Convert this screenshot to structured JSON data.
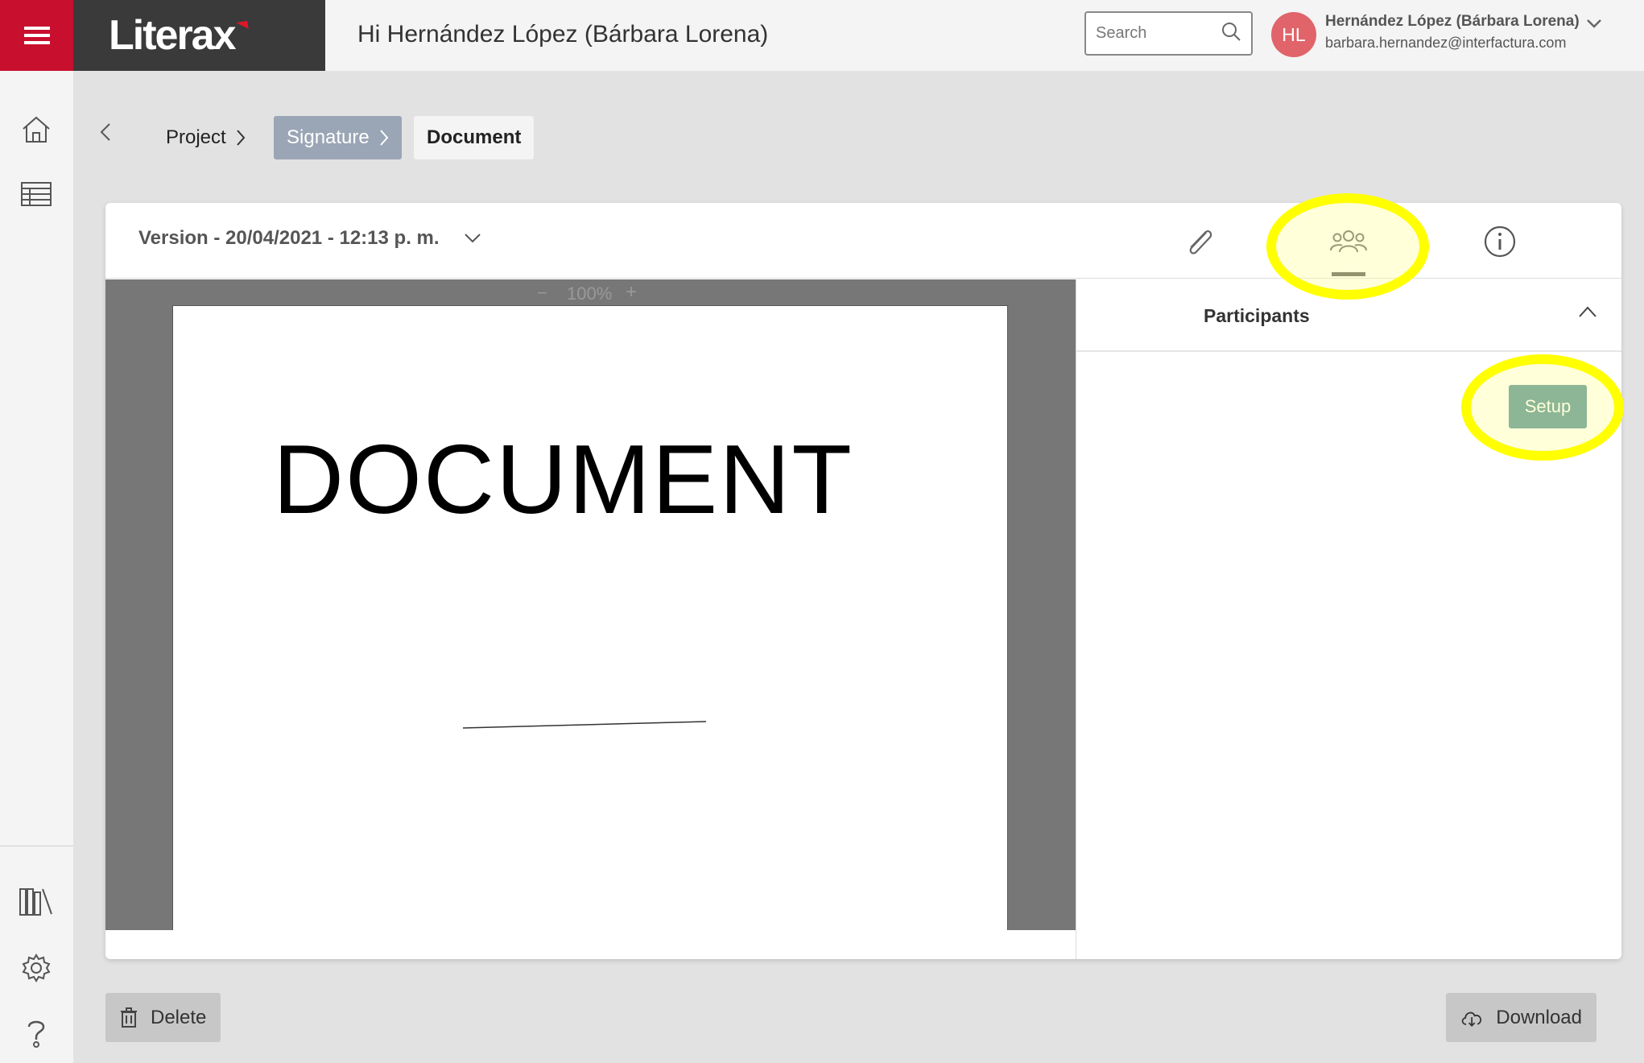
{
  "header": {
    "brand": "Literax",
    "greeting": "Hi Hernández López (Bárbara Lorena)",
    "search_placeholder": "Search",
    "user": {
      "initials": "HL",
      "name": "Hernández López (Bárbara Lorena)",
      "email": "barbara.hernandez@interfactura.com"
    }
  },
  "sidebar": {
    "items": [
      {
        "icon": "home-icon"
      },
      {
        "icon": "table-icon"
      },
      {
        "icon": "library-icon"
      },
      {
        "icon": "gear-icon"
      },
      {
        "icon": "help-icon"
      }
    ]
  },
  "breadcrumb": {
    "items": [
      "Project",
      "Signature",
      "Document"
    ]
  },
  "document": {
    "version_label": "Version - 20/04/2021 - 12:13 p. m.",
    "zoom": "100%",
    "zoom_minus": "−",
    "zoom_plus": "+",
    "page_text": "DOCUMENT"
  },
  "tabs": [
    {
      "icon": "paperclip-icon"
    },
    {
      "icon": "participants-icon"
    },
    {
      "icon": "info-icon"
    }
  ],
  "panel": {
    "title": "Participants",
    "setup_label": "Setup"
  },
  "actions": {
    "delete_label": "Delete",
    "download_label": "Download"
  },
  "colors": {
    "brand_red": "#c8102e",
    "setup_teal": "#4f8f95",
    "highlight": "#ffff00",
    "avatar": "#e0646a"
  }
}
